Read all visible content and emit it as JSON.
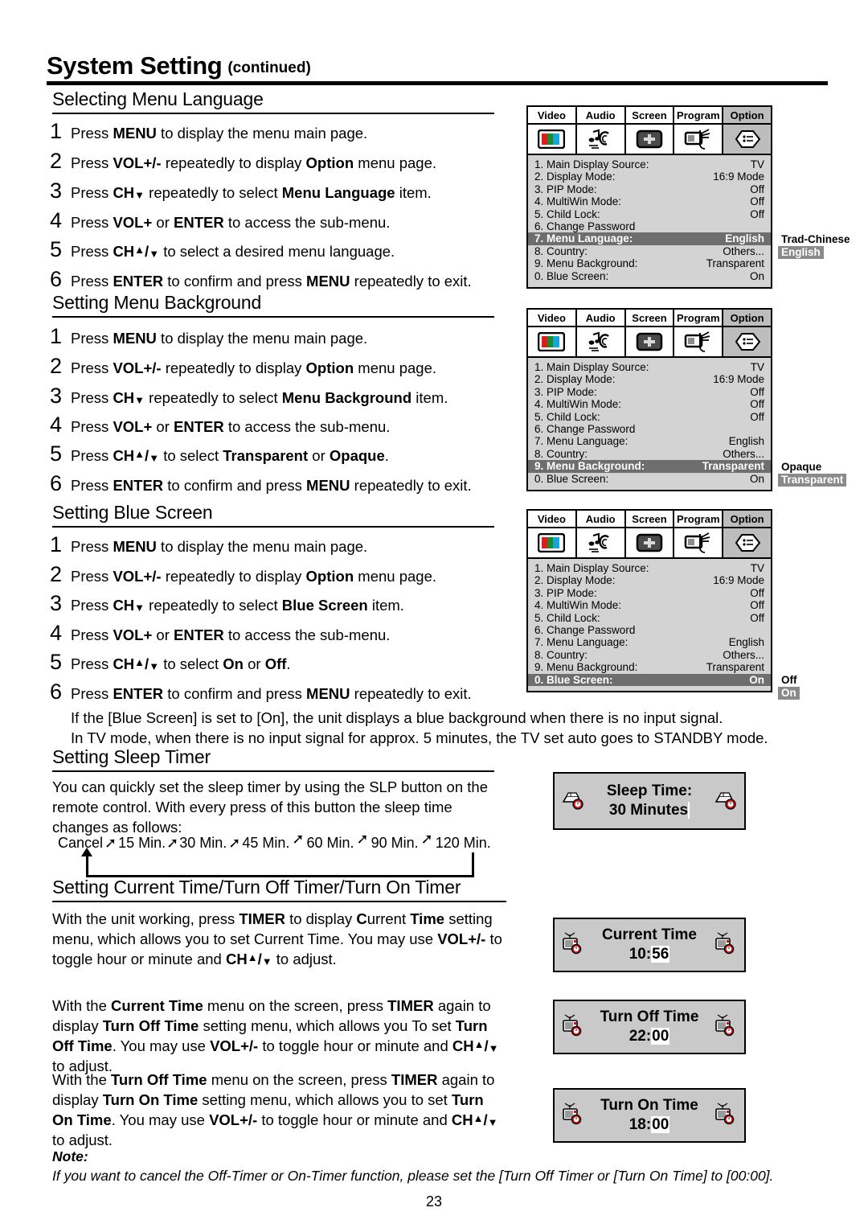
{
  "header": {
    "title": "System Setting",
    "subtitle": "(continued)"
  },
  "sections": [
    {
      "id": "menu-language",
      "heading": "Selecting Menu Language",
      "steps": [
        {
          "n": "1",
          "html": "Press <b>MENU</b> to display the menu main page."
        },
        {
          "n": "2",
          "html": "Press <b>VOL+/-</b> repeatedly to display <b>Option</b> menu page."
        },
        {
          "n": "3",
          "html": "Press <b>CH</b><span class=\"arrD\">&#9660;</span> repeatedly to select <b>Menu Language</b> item."
        },
        {
          "n": "4",
          "html": "Press <b>VOL+</b> or <b>ENTER</b> to access the sub-menu."
        },
        {
          "n": "5",
          "html": "Press <b>CH</b><span class=\"arrU\">&#9650;</span><b class=\"sl\">/</b><span class=\"arrD\">&#9660;</span> to select a desired menu language."
        },
        {
          "n": "6",
          "html": "Press <b>ENTER</b> to confirm and press <b>MENU</b> repeatedly to exit."
        }
      ]
    },
    {
      "id": "menu-background",
      "heading": "Setting Menu Background",
      "steps": [
        {
          "n": "1",
          "html": "Press <b>MENU</b> to display the menu main page."
        },
        {
          "n": "2",
          "html": "Press <b>VOL+/-</b> repeatedly to display <b>Option</b> menu page."
        },
        {
          "n": "3",
          "html": "Press <b>CH</b><span class=\"arrD\">&#9660;</span> repeatedly to select <b>Menu Background</b> item."
        },
        {
          "n": "4",
          "html": "Press <b>VOL+</b> or <b>ENTER</b> to access the sub-menu."
        },
        {
          "n": "5",
          "html": "Press <b>CH</b><span class=\"arrU\">&#9650;</span><b class=\"sl\">/</b><span class=\"arrD\">&#9660;</span> to select <b>Transparent</b> or <b>Opaque</b>."
        },
        {
          "n": "6",
          "html": "Press <b>ENTER</b> to confirm and press <b>MENU</b> repeatedly to exit."
        }
      ]
    },
    {
      "id": "blue-screen",
      "heading": "Setting Blue Screen",
      "steps": [
        {
          "n": "1",
          "html": "Press <b>MENU</b> to display the menu main page."
        },
        {
          "n": "2",
          "html": "Press <b>VOL+/-</b> repeatedly to display <b>Option</b> menu page."
        },
        {
          "n": "3",
          "html": "Press <b>CH</b><span class=\"arrD\">&#9660;</span> repeatedly to select <b>Blue Screen</b> item."
        },
        {
          "n": "4",
          "html": "Press <b>VOL+</b> or <b>ENTER</b> to access the sub-menu."
        },
        {
          "n": "5",
          "html": "Press <b>CH</b><span class=\"arrU\">&#9650;</span><b class=\"sl\">/</b><span class=\"arrD\">&#9660;</span> to select <b>On</b> or <b>Off</b>."
        },
        {
          "n": "6",
          "html": "Press <b>ENTER</b> to confirm and press <b>MENU</b> repeatedly to exit."
        }
      ]
    }
  ],
  "blue_screen_note": {
    "line1": "If the [Blue Screen] is set to [On], the unit displays a blue background when there is no input signal.",
    "line2": "In TV mode, when there is no input signal for approx. 5 minutes, the TV set auto goes to STANDBY mode."
  },
  "sleep_timer": {
    "heading": "Setting Sleep Timer",
    "paragraph": "You can quickly set the sleep timer by using the SLP button on the remote control. With every press of this button the sleep time changes as follows:",
    "flow": [
      "Cancel",
      "15 Min.",
      "30 Min.",
      "45 Min.",
      "60 Min.",
      "90 Min.",
      "120 Min."
    ]
  },
  "current_time_section": {
    "heading": "Setting Current Time/Turn Off Timer/Turn On Timer",
    "p1": "With the unit working, press <b>TIMER</b> to display <b>C</b>urrent <b>Time</b> setting menu, which allows you to set Current Time. You may use <b>VOL+/-</b> to toggle hour or minute and <b>CH</b><span class=\"arrU\">&#9650;</span><b class=\"sl\">/</b><span class=\"arrD\">&#9660;</span> to adjust.",
    "p2": "With the <b>Current Time</b> menu on the screen, press <b>TIMER</b> again to display <b>Turn Off Time</b> setting menu, which allows you To set <b>Turn Off Time</b>. You may use <b>VOL+/-</b> to toggle hour or minute and <b>CH</b><span class=\"arrU\">&#9650;</span><b class=\"sl\">/</b><span class=\"arrD\">&#9660;</span> to adjust.",
    "p3": "With the <b>Turn Off Time</b> menu on the screen, press <b>TIMER</b> again to display <b>Turn On Time</b> setting menu, which allows you to set <b>Turn On Time</b>. You may use <b>VOL+/-</b> to toggle hour or minute and <b>CH</b><span class=\"arrU\">&#9650;</span><b class=\"sl\">/</b><span class=\"arrD\">&#9660;</span> to adjust."
  },
  "note": {
    "label": "Note:",
    "text": "If you want to cancel the Off-Timer or On-Timer function, please set the [Turn Off Timer or [Turn On Time] to [00:00]."
  },
  "osd": {
    "tabs": [
      "Video",
      "Audio",
      "Screen",
      "Program",
      "Option"
    ],
    "tab_icons": [
      "color-bars-icon",
      "audio-note-ear-icon",
      "screen-plus-icon",
      "program-antenna-icon",
      "option-list-icon"
    ],
    "active_tab": "Option",
    "panels": [
      {
        "id": "panel-menu-language",
        "rows": [
          {
            "label": "1. Main Display Source:",
            "value": "TV"
          },
          {
            "label": "2. Display Mode:",
            "value": "16:9 Mode"
          },
          {
            "label": "3. PIP Mode:",
            "value": "Off"
          },
          {
            "label": "4. MultiWin Mode:",
            "value": "Off"
          },
          {
            "label": "5. Child Lock:",
            "value": "Off"
          },
          {
            "label": "6. Change Password",
            "value": ""
          },
          {
            "label": "7. Menu Language:",
            "value": "English",
            "selected": true
          },
          {
            "label": "8. Country:",
            "value": "Others..."
          },
          {
            "label": "9. Menu Background:",
            "value": "Transparent"
          },
          {
            "label": "0. Blue Screen:",
            "value": "On"
          }
        ],
        "popup": {
          "options": [
            "Trad-Chinese",
            "English"
          ],
          "selected": "English"
        }
      },
      {
        "id": "panel-menu-background",
        "rows": [
          {
            "label": "1. Main Display Source:",
            "value": "TV"
          },
          {
            "label": "2. Display Mode:",
            "value": "16:9 Mode"
          },
          {
            "label": "3. PIP Mode:",
            "value": "Off"
          },
          {
            "label": "4. MultiWin Mode:",
            "value": "Off"
          },
          {
            "label": "5. Child Lock:",
            "value": "Off"
          },
          {
            "label": "6. Change Password",
            "value": ""
          },
          {
            "label": "7. Menu Language:",
            "value": "English"
          },
          {
            "label": "8. Country:",
            "value": "Others..."
          },
          {
            "label": "9. Menu Background:",
            "value": "Transparent",
            "selected": true
          },
          {
            "label": "0. Blue Screen:",
            "value": "On"
          }
        ],
        "popup": {
          "options": [
            "Opaque",
            "Transparent"
          ],
          "selected": "Transparent"
        }
      },
      {
        "id": "panel-blue-screen",
        "rows": [
          {
            "label": "1. Main Display Source:",
            "value": "TV"
          },
          {
            "label": "2. Display Mode:",
            "value": "16:9 Mode"
          },
          {
            "label": "3. PIP Mode:",
            "value": "Off"
          },
          {
            "label": "4. MultiWin Mode:",
            "value": "Off"
          },
          {
            "label": "5. Child Lock:",
            "value": "Off"
          },
          {
            "label": "6. Change Password",
            "value": ""
          },
          {
            "label": "7. Menu Language:",
            "value": "English"
          },
          {
            "label": "8. Country:",
            "value": "Others..."
          },
          {
            "label": "9. Menu Background:",
            "value": "Transparent"
          },
          {
            "label": "0. Blue Screen:",
            "value": "On",
            "selected": true
          }
        ],
        "popup": {
          "options": [
            "Off",
            "On"
          ],
          "selected": "On"
        }
      }
    ]
  },
  "status_boxes": [
    {
      "id": "sleep-time-box",
      "title": "Sleep Time:",
      "value_plain": "30 Minutes",
      "value_hl": "",
      "icon": "bed-clock-icon"
    },
    {
      "id": "current-time-box",
      "title": "Current Time",
      "value_plain": "10:",
      "value_hl": "56",
      "icon": "tv-clock-icon"
    },
    {
      "id": "turn-off-time-box",
      "title": "Turn Off Time",
      "value_plain": "22:",
      "value_hl": "00",
      "icon": "tv-clock-icon"
    },
    {
      "id": "turn-on-time-box",
      "title": "Turn On Time",
      "value_plain": "18:",
      "value_hl": "00",
      "icon": "tv-clock-icon"
    }
  ],
  "page_number": "23",
  "colors": {
    "panel_bg": "#d3d3d3",
    "tab_active_bg": "#bdbdbd",
    "row_selected_bg": "#6e6e6e",
    "popup_selected_bg": "#8a8a8a",
    "status_box_bg": "#c9c9c9",
    "clock_red": "#cc1111"
  }
}
